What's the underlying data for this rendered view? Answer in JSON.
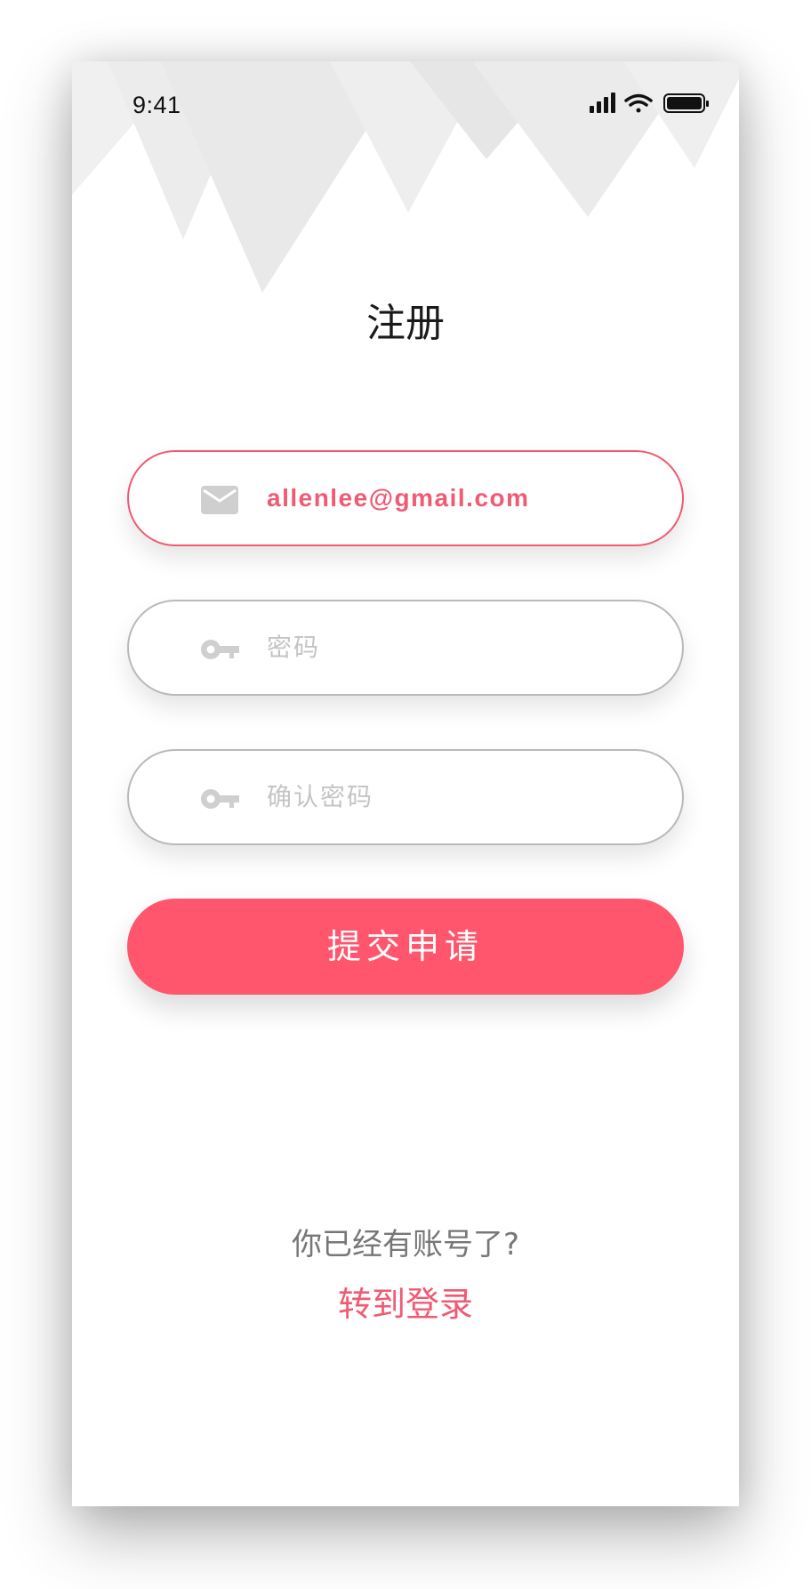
{
  "status_bar": {
    "time": "9:41"
  },
  "page": {
    "title": "注册"
  },
  "form": {
    "email_value": "allenlee@gmail.com",
    "password_placeholder": "密码",
    "confirm_placeholder": "确认密码",
    "submit_label": "提交申请"
  },
  "footer": {
    "question": "你已经有账号了?",
    "login_link": "转到登录"
  },
  "icons": {
    "email": "mail-icon",
    "password": "key-icon",
    "confirm": "key-icon"
  },
  "colors": {
    "accent": "#ff566d",
    "accent_text": "#f05a72",
    "placeholder": "#c4c4c4",
    "border_idle": "#b9b9b9"
  }
}
